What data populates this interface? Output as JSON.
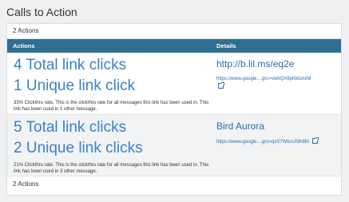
{
  "page": {
    "title": "Calls to Action"
  },
  "summary": {
    "top_count": "2 Actions",
    "bottom_count": "2 Actions"
  },
  "table": {
    "headers": {
      "actions": "Actions",
      "details": "Details"
    },
    "rows": [
      {
        "total_clicks": "4 Total link clicks",
        "unique_clicks": "1 Unique link click",
        "description": "33% Clickthru rate. This is the clickthru rate for all messages this link has been used in. This link has been used in 1 other message.",
        "link_title": "http://b.lil.ms/eq2e",
        "link_url": "https://www.google....grc=vwbQA9pKktomIM"
      },
      {
        "total_clicks": "5 Total link clicks",
        "unique_clicks": "2 Unique link clicks",
        "description": "21% Clickthru rate. This is the clickthru rate for all messages this link has been used in. This link has been used in 3 other message.",
        "link_title": "Bird Aurora",
        "link_url": "https://www.google....grc=qxS7WlcnJSlh8M"
      }
    ]
  }
}
